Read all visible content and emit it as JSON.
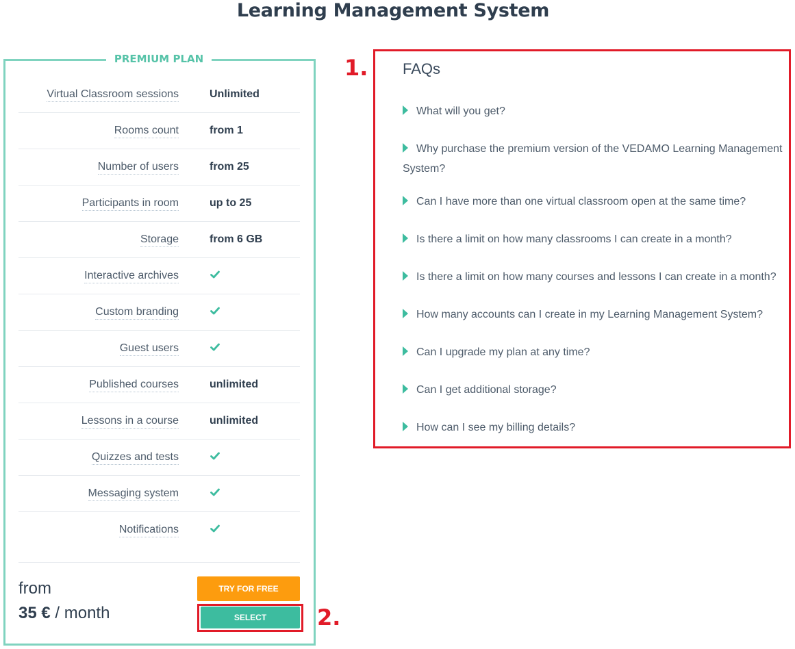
{
  "page": {
    "title": "Learning Management System"
  },
  "plan": {
    "heading": "PREMIUM PLAN",
    "features": [
      {
        "name": "Virtual Classroom sessions",
        "value": "Unlimited",
        "check": false
      },
      {
        "name": "Rooms count",
        "value": "from 1",
        "check": false
      },
      {
        "name": "Number of users",
        "value": "from 25",
        "check": false
      },
      {
        "name": "Participants in room",
        "value": "up to 25",
        "check": false
      },
      {
        "name": "Storage",
        "value": "from 6 GB",
        "check": false
      },
      {
        "name": "Interactive archives",
        "value": "",
        "check": true
      },
      {
        "name": "Custom branding",
        "value": "",
        "check": true
      },
      {
        "name": "Guest users",
        "value": "",
        "check": true
      },
      {
        "name": "Published courses",
        "value": "unlimited",
        "check": false
      },
      {
        "name": "Lessons in a course",
        "value": "unlimited",
        "check": false
      },
      {
        "name": "Quizzes and tests",
        "value": "",
        "check": true
      },
      {
        "name": "Messaging system",
        "value": "",
        "check": true
      },
      {
        "name": "Notifications",
        "value": "",
        "check": true
      }
    ],
    "price_prefix": "from",
    "price_amount": "35 €",
    "price_period": " / month",
    "try_label": "TRY FOR FREE",
    "select_label": "SELECT"
  },
  "annotations": {
    "first": "1.",
    "second": "2."
  },
  "faq": {
    "title": "FAQs",
    "items": [
      "What will you get?",
      "Why purchase the premium version of the VEDAMO Learning Management System?",
      "Can I have more than one virtual classroom open at the same time?",
      "Is there a limit on how many classrooms I can create in a month?",
      "Is there a limit on how many courses and lessons I can create in a month?",
      "How many accounts can I create in my Learning Management System?",
      "Can I upgrade my plan at any time?",
      "Can I get additional storage?",
      "How can I see my billing details?"
    ]
  },
  "colors": {
    "accent": "#3dbc9f",
    "card_border": "#7fd3bf",
    "try_button": "#fd9c0e",
    "highlight": "#e11b28"
  },
  "icons": {
    "check": "check-icon",
    "caret": "caret-right-icon"
  }
}
